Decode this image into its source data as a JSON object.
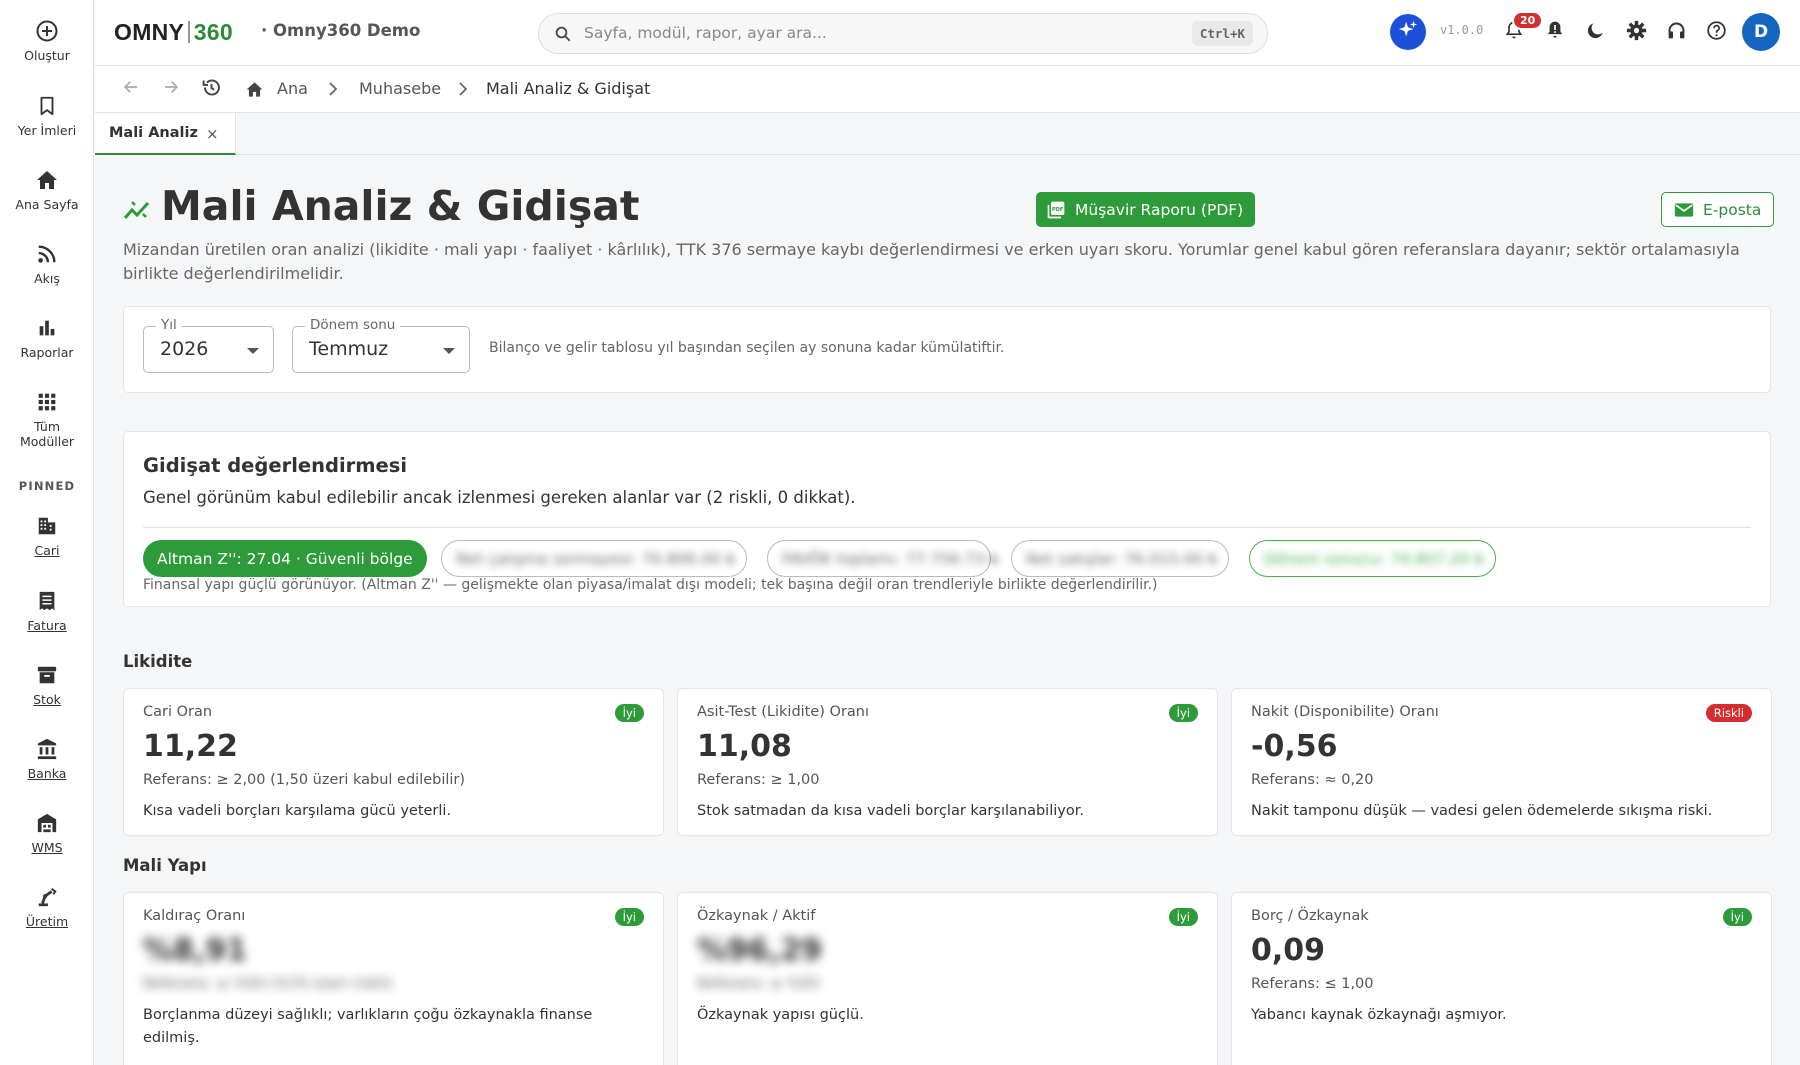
{
  "rail": {
    "items": [
      {
        "label": "Oluştur",
        "icon": "plus-circle-icon"
      },
      {
        "label": "Yer İmleri",
        "icon": "bookmark-icon"
      },
      {
        "label": "Ana Sayfa",
        "icon": "home-icon"
      },
      {
        "label": "Akış",
        "icon": "rss-icon"
      },
      {
        "label": "Raporlar",
        "icon": "bar-chart-icon"
      },
      {
        "label": "Tüm Modüller",
        "icon": "grid-icon"
      }
    ],
    "pinned_header": "PINNED",
    "pinned": [
      {
        "label": "Cari",
        "icon": "building-icon"
      },
      {
        "label": "Fatura",
        "icon": "receipt-icon"
      },
      {
        "label": "Stok",
        "icon": "archive-icon"
      },
      {
        "label": "Banka",
        "icon": "bank-icon"
      },
      {
        "label": "WMS",
        "icon": "warehouse-icon"
      },
      {
        "label": "Üretim",
        "icon": "robot-arm-icon"
      }
    ]
  },
  "topbar": {
    "logo_left": "OMNY",
    "logo_right": "360",
    "company": "· Omny360 Demo",
    "search_placeholder": "Sayfa, modül, rapor, ayar ara...",
    "search_shortcut": "Ctrl+K",
    "version": "v1.0.0",
    "notification_count": "20",
    "avatar_initial": "D"
  },
  "breadcrumb": {
    "items": [
      "Ana",
      "Muhasebe",
      "Mali Analiz & Gidişat"
    ]
  },
  "tabs": [
    {
      "label": "Mali Analiz",
      "close": "×"
    }
  ],
  "page": {
    "title": "Mali Analiz & Gidişat",
    "pdf_button": "Müşavir Raporu (PDF)",
    "email_button": "E-posta",
    "subtitle": "Mizandan üretilen oran analizi (likidite · mali yapı · faaliyet · kârlılık), TTK 376 sermaye kaybı değerlendirmesi ve erken uyarı skoru. Yorumlar genel kabul gören referanslara dayanır; sektör ortalamasıyla birlikte değerlendirilmelidir."
  },
  "filters": {
    "year_label": "Yıl",
    "year_value": "2026",
    "period_label": "Dönem sonu",
    "period_value": "Temmuz",
    "note": "Bilanço ve gelir tablosu yıl başından seçilen ay sonuna kadar kümülatiftir."
  },
  "assessment": {
    "title": "Gidişat değerlendirmesi",
    "summary": "Genel görünüm kabul edilebilir ancak izlenmesi gereken alanlar var (2 riskli, 0 dikkat).",
    "chips": [
      {
        "text": "Altman Z'': 27.04 · Güvenli bölge",
        "style": "green"
      },
      {
        "text": "Net çalışma sermayesi: 70.806.00 ₺",
        "style": "blur"
      },
      {
        "text": "FAVÖK toplamı: 77.756.73 ₺",
        "style": "blur"
      },
      {
        "text": "Net satışlar: 76.015.00 ₺",
        "style": "blur"
      },
      {
        "text": "Dönem sonucu: 74.807.20 ₺",
        "style": "blur-green"
      }
    ],
    "note": "Finansal yapı güçlü görünüyor. (Altman Z'' — gelişmekte olan piyasa/imalat dışı modeli; tek başına değil oran trendleriyle birlikte değerlendirilir.)"
  },
  "sections": [
    {
      "title": "Likidite",
      "cards": [
        {
          "name": "Cari Oran",
          "status": "İyi",
          "status_kind": "good",
          "value": "11,22",
          "reference": "Referans: ≥ 2,00 (1,50 üzeri kabul edilebilir)",
          "comment": "Kısa vadeli borçları karşılama gücü yeterli.",
          "blurred": false
        },
        {
          "name": "Asit-Test (Likidite) Oranı",
          "status": "İyi",
          "status_kind": "good",
          "value": "11,08",
          "reference": "Referans: ≥ 1,00",
          "comment": "Stok satmadan da kısa vadeli borçlar karşılanabiliyor.",
          "blurred": false
        },
        {
          "name": "Nakit (Disponibilite) Oranı",
          "status": "Riskli",
          "status_kind": "bad",
          "value": "-0,56",
          "reference": "Referans: ≈ 0,20",
          "comment": "Nakit tamponu düşük — vadesi gelen ödemelerde sıkışma riski.",
          "blurred": false
        }
      ]
    },
    {
      "title": "Mali Yapı",
      "cards": [
        {
          "name": "Kaldıraç Oranı",
          "status": "İyi",
          "status_kind": "good",
          "value": "%8,91",
          "reference": "Referans: ≤ %50 (%70 üzeri riskli)",
          "comment": "Borçlanma düzeyi sağlıklı; varlıkların çoğu özkaynakla finanse edilmiş.",
          "blurred": true
        },
        {
          "name": "Özkaynak / Aktif",
          "status": "İyi",
          "status_kind": "good",
          "value": "%96,29",
          "reference": "Referans: ≥ %50",
          "comment": "Özkaynak yapısı güçlü.",
          "blurred": true
        },
        {
          "name": "Borç / Özkaynak",
          "status": "İyi",
          "status_kind": "good",
          "value": "0,09",
          "reference": "Referans: ≤ 1,00",
          "comment": "Yabancı kaynak özkaynağı aşmıyor.",
          "blurred": false
        }
      ]
    }
  ],
  "colors": {
    "brand_green": "#2e9b3a",
    "risk_red": "#d32f2f",
    "ai_blue": "#1d4fd8",
    "avatar_blue": "#1565c0"
  }
}
